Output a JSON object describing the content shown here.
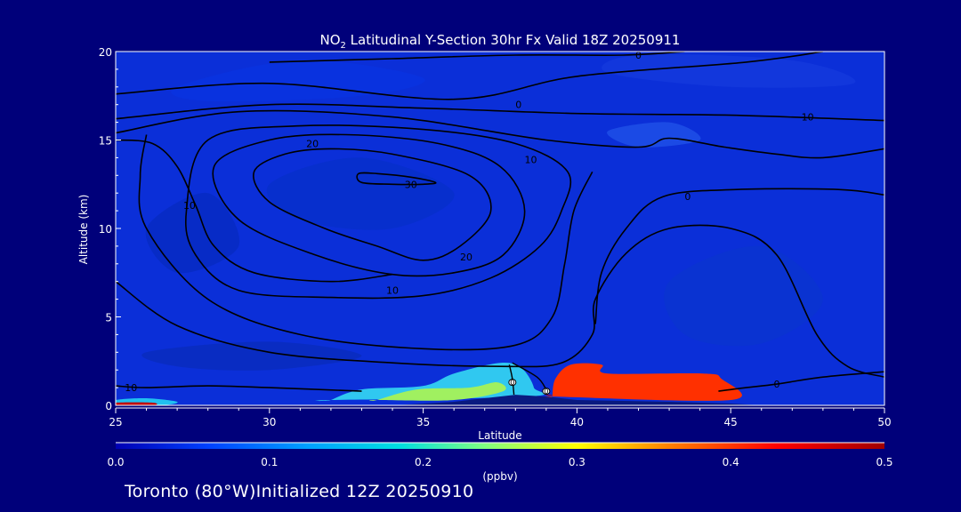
{
  "chart_data": {
    "type": "heatmap",
    "title_prefix": "NO",
    "title_sub": "2",
    "title_suffix": " Latitudinal Y-Section 30hr  Fx Valid 18Z 20250911",
    "xlabel": "Latitude",
    "ylabel": "Altitude (km)",
    "xlim": [
      25,
      50
    ],
    "ylim": [
      0,
      20
    ],
    "x_ticks": [
      25,
      30,
      35,
      40,
      45,
      50
    ],
    "y_ticks": [
      0,
      5,
      10,
      15,
      20
    ],
    "colorbar": {
      "range": [
        0.0,
        0.5
      ],
      "ticks": [
        "0.0",
        "0.1",
        "0.2",
        "0.3",
        "0.4",
        "0.5"
      ],
      "unit_label": "(ppbv)",
      "colors": [
        "#0000b4",
        "#0040ff",
        "#00a0ff",
        "#00e0e0",
        "#80ff80",
        "#ffff00",
        "#ff8000",
        "#ff0000",
        "#a00000"
      ]
    },
    "field_background": "#0b2fd8",
    "concentration_regions": [
      {
        "level": 0.45,
        "color": "#c80000",
        "points": [
          [
            39.2,
            0.6
          ],
          [
            39.4,
            1.4
          ],
          [
            39.8,
            2.1
          ],
          [
            40.6,
            2.2
          ],
          [
            41.0,
            1.6
          ],
          [
            44.0,
            1.6
          ],
          [
            44.6,
            1.4
          ],
          [
            44.9,
            0.4
          ],
          [
            42.0,
            0.5
          ],
          [
            39.2,
            0.6
          ]
        ]
      },
      {
        "level": 0.38,
        "color": "#ff3000",
        "points": [
          [
            39.2,
            0.5
          ],
          [
            39.3,
            1.5
          ],
          [
            39.8,
            2.3
          ],
          [
            40.8,
            2.3
          ],
          [
            41.0,
            1.8
          ],
          [
            44.1,
            1.8
          ],
          [
            44.7,
            1.5
          ],
          [
            45.0,
            0.3
          ],
          [
            39.2,
            0.5
          ]
        ]
      },
      {
        "level": 0.15,
        "color": "#30c8f0",
        "points": [
          [
            32.0,
            0.3
          ],
          [
            33.0,
            0.9
          ],
          [
            35.0,
            1.1
          ],
          [
            36.0,
            1.8
          ],
          [
            37.5,
            2.4
          ],
          [
            38.2,
            2.1
          ],
          [
            38.6,
            1.0
          ],
          [
            38.4,
            0.5
          ],
          [
            32.0,
            0.3
          ]
        ]
      },
      {
        "level": 0.22,
        "color": "#a0f060",
        "points": [
          [
            33.5,
            0.3
          ],
          [
            34.8,
            0.9
          ],
          [
            36.5,
            1.0
          ],
          [
            37.4,
            1.3
          ],
          [
            37.6,
            0.8
          ],
          [
            36.0,
            0.3
          ],
          [
            33.5,
            0.3
          ]
        ]
      },
      {
        "level": 0.12,
        "color": "#20c0f0",
        "points": [
          [
            25.0,
            0.0
          ],
          [
            25.0,
            0.3
          ],
          [
            26.0,
            0.4
          ],
          [
            27.0,
            0.2
          ],
          [
            26.5,
            0.0
          ],
          [
            25.0,
            0.0
          ]
        ]
      },
      {
        "level": 0.5,
        "color": "#c00000",
        "points": [
          [
            25.0,
            0.0
          ],
          [
            25.0,
            0.15
          ],
          [
            26.2,
            0.15
          ],
          [
            26.2,
            0.0
          ],
          [
            25.0,
            0.0
          ]
        ]
      }
    ],
    "terrain": [
      [
        25,
        0
      ],
      [
        34,
        0
      ],
      [
        36,
        0.2
      ],
      [
        37,
        0.4
      ],
      [
        38,
        0.6
      ],
      [
        39,
        0.5
      ],
      [
        40,
        0.3
      ],
      [
        43,
        0.2
      ],
      [
        45,
        0.1
      ],
      [
        46,
        0
      ],
      [
        50,
        0
      ]
    ],
    "contours": [
      {
        "label": "30",
        "label_at": [
          34.6,
          12.5
        ],
        "points": [
          [
            32.9,
            13.1
          ],
          [
            33.0,
            12.6
          ],
          [
            34.0,
            12.5
          ],
          [
            35.0,
            12.5
          ],
          [
            35.4,
            12.6
          ],
          [
            34.6,
            12.9
          ],
          [
            33.5,
            13.1
          ],
          [
            32.9,
            13.1
          ]
        ]
      },
      {
        "label": "20",
        "label_at": [
          31.4,
          14.8
        ],
        "points": [
          [
            29.5,
            13.2
          ],
          [
            30.5,
            14.2
          ],
          [
            32.0,
            14.5
          ],
          [
            34.0,
            14.2
          ],
          [
            36.5,
            13.0
          ],
          [
            37.2,
            11.0
          ],
          [
            36.2,
            9.0
          ],
          [
            35.0,
            8.2
          ],
          [
            33.5,
            9.0
          ],
          [
            31.8,
            10.0
          ],
          [
            30.0,
            11.5
          ],
          [
            29.5,
            13.2
          ]
        ]
      },
      {
        "label": "20",
        "label_at": [
          36.4,
          8.4
        ],
        "points": [
          [
            28.2,
            13.5
          ],
          [
            30.0,
            15.0
          ],
          [
            32.5,
            15.3
          ],
          [
            35.5,
            14.8
          ],
          [
            37.5,
            13.5
          ],
          [
            38.3,
            11.0
          ],
          [
            37.6,
            8.5
          ],
          [
            36.0,
            7.5
          ],
          [
            34.0,
            7.4
          ],
          [
            31.5,
            8.5
          ],
          [
            29.0,
            10.5
          ],
          [
            28.2,
            13.5
          ]
        ]
      },
      {
        "label": "10",
        "label_at": [
          34.0,
          6.5
        ],
        "points": [
          [
            28.0,
            15.0
          ],
          [
            31.0,
            15.8
          ],
          [
            35.0,
            15.6
          ],
          [
            38.0,
            14.8
          ],
          [
            39.7,
            13.2
          ],
          [
            39.5,
            11.0
          ],
          [
            38.8,
            9.0
          ],
          [
            37.2,
            7.2
          ],
          [
            35.0,
            6.2
          ],
          [
            32.0,
            6.1
          ],
          [
            29.0,
            6.5
          ],
          [
            27.6,
            8.5
          ],
          [
            27.3,
            11.0
          ],
          [
            28.0,
            15.0
          ]
        ]
      },
      {
        "label": "10",
        "label_at": [
          27.4,
          11.3
        ],
        "points": [
          [
            25.0,
            15.0
          ],
          [
            26.2,
            14.8
          ],
          [
            27.0,
            13.5
          ],
          [
            27.6,
            11.3
          ],
          [
            28.2,
            9.0
          ],
          [
            29.5,
            7.5
          ],
          [
            32.0,
            7.0
          ],
          [
            34.0,
            7.4
          ]
        ]
      },
      {
        "label": "10",
        "label_at": [
          38.5,
          13.9
        ],
        "points": [
          [
            25.0,
            15.4
          ],
          [
            29.0,
            16.6
          ],
          [
            34.0,
            16.3
          ],
          [
            39.0,
            15.0
          ],
          [
            42.0,
            14.6
          ],
          [
            43.0,
            15.1
          ],
          [
            44.8,
            14.6
          ],
          [
            46.5,
            14.2
          ],
          [
            48.0,
            14.0
          ],
          [
            50.0,
            14.5
          ]
        ]
      },
      {
        "label": "10",
        "label_at": [
          47.5,
          16.3
        ],
        "points": [
          [
            25.0,
            16.2
          ],
          [
            30.0,
            17.0
          ],
          [
            35.0,
            16.8
          ],
          [
            40.0,
            16.5
          ],
          [
            45.0,
            16.4
          ],
          [
            50.0,
            16.1
          ]
        ]
      },
      {
        "label": "0",
        "label_at": [
          38.1,
          17.0
        ],
        "points": [
          [
            25.0,
            17.6
          ],
          [
            30.0,
            18.2
          ],
          [
            36.0,
            17.3
          ],
          [
            40.0,
            18.6
          ],
          [
            45.5,
            19.4
          ],
          [
            48.0,
            20.0
          ]
        ]
      },
      {
        "label": "0",
        "label_at": [
          42.0,
          19.8
        ],
        "points": [
          [
            30.0,
            19.4
          ],
          [
            34.0,
            19.6
          ],
          [
            38.0,
            19.8
          ],
          [
            41.5,
            19.8
          ],
          [
            43.5,
            20.0
          ]
        ]
      },
      {
        "label": "0",
        "label_at": [
          43.6,
          11.8
        ],
        "points": [
          [
            40.6,
            4.6
          ],
          [
            40.8,
            7.5
          ],
          [
            41.6,
            10.0
          ],
          [
            42.8,
            11.8
          ],
          [
            45.2,
            12.2
          ],
          [
            48.5,
            12.2
          ],
          [
            50.0,
            11.9
          ]
        ]
      },
      {
        "label": "0",
        "label_at": [
          46.5,
          1.2
        ],
        "points": [
          [
            44.6,
            0.8
          ],
          [
            45.5,
            1.0
          ],
          [
            46.5,
            1.2
          ],
          [
            48.0,
            1.6
          ],
          [
            50.0,
            1.9
          ]
        ]
      },
      {
        "label": "10",
        "label_at": [
          25.5,
          1.0
        ],
        "points": [
          [
            25.0,
            1.1
          ],
          [
            26.0,
            1.0
          ],
          [
            28.0,
            1.1
          ],
          [
            30.0,
            1.0
          ],
          [
            33.0,
            0.8
          ]
        ]
      },
      {
        "label": "",
        "label_at": null,
        "points": [
          [
            25.0,
            7.0
          ],
          [
            27.0,
            4.5
          ],
          [
            30.0,
            3.0
          ],
          [
            34.0,
            2.4
          ],
          [
            37.5,
            2.2
          ],
          [
            39.5,
            2.4
          ],
          [
            40.5,
            4.0
          ],
          [
            40.6,
            6.0
          ],
          [
            41.6,
            8.6
          ],
          [
            43.0,
            10.0
          ],
          [
            45.0,
            10.0
          ],
          [
            46.5,
            8.5
          ],
          [
            47.8,
            4.0
          ],
          [
            48.8,
            2.2
          ],
          [
            50.0,
            1.6
          ]
        ]
      },
      {
        "label": "",
        "label_at": null,
        "points": [
          [
            26.0,
            15.3
          ],
          [
            25.8,
            13.0
          ],
          [
            26.0,
            10.0
          ],
          [
            28.0,
            6.0
          ],
          [
            31.0,
            4.0
          ],
          [
            35.0,
            3.2
          ],
          [
            38.0,
            3.4
          ],
          [
            39.2,
            5.0
          ],
          [
            39.6,
            8.0
          ],
          [
            39.9,
            11.0
          ],
          [
            40.5,
            13.2
          ]
        ]
      }
    ],
    "contour_markers": [
      {
        "label": "0",
        "at": [
          37.9,
          1.3
        ]
      },
      {
        "label": "0",
        "at": [
          39.0,
          0.8
        ]
      }
    ],
    "marker_lines": [
      {
        "points": [
          [
            37.8,
            2.3
          ],
          [
            37.9,
            1.5
          ],
          [
            37.95,
            0.6
          ]
        ]
      },
      {
        "points": [
          [
            37.9,
            2.4
          ],
          [
            38.7,
            1.6
          ],
          [
            39.0,
            0.9
          ]
        ]
      }
    ]
  },
  "footer": {
    "label": "Toronto (80°W)Initialized 12Z 20250910"
  }
}
